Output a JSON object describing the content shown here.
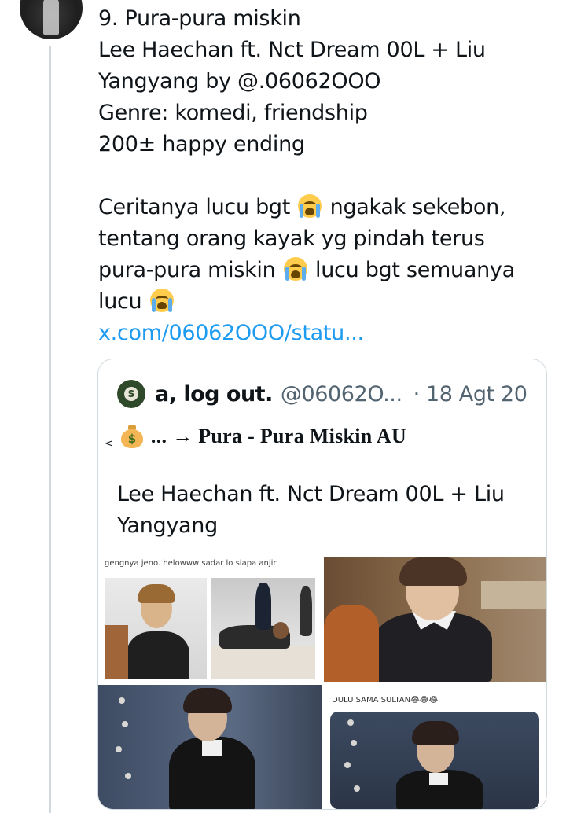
{
  "tweet": {
    "lines": [
      "9. Pura-pura miskin",
      "Lee Haechan ft. Nct Dream 00L + Liu",
      "Yangyang by @.06062OOO",
      "Genre: komedi, friendship",
      "200± happy ending"
    ],
    "body": {
      "line1_a": "Ceritanya lucu bgt",
      "line1_b": "ngakak sekebon,",
      "line2": "tentang orang kayak yg pindah terus",
      "line3_a": "pura-pura miskin",
      "line3_b": "lucu bgt semuanya",
      "line4": "lucu"
    },
    "link": "x.com/06062OOO/statu...",
    "emoji": "loudly-crying-face-icon"
  },
  "quote": {
    "name": "a, log out.",
    "handle": "@06062O...",
    "date": "· 18 Agt 20",
    "avatar_letter": "S",
    "au_prefix": "<",
    "au_title": "... → Pura - Pura Miskin AU",
    "text_lines": [
      "Lee Haechan ft. Nct Dream 00L + Liu",
      "Yangyang"
    ],
    "media": {
      "caption_1": "gengnya jeno. helowww sadar lo siapa anjir",
      "caption_4": "DULU SAMA SULTAN😂😂😂"
    }
  },
  "colors": {
    "link": "#1d9bf0",
    "secondary_text": "#536471",
    "border": "#cfd9de"
  }
}
